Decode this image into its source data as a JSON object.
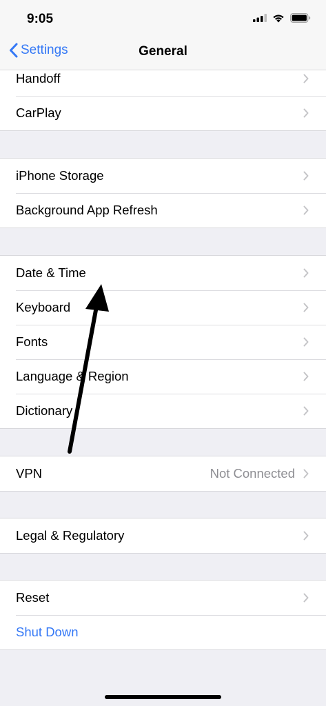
{
  "status_bar": {
    "time": "9:05",
    "icons": [
      "cellular-signal-icon",
      "wifi-icon",
      "battery-icon"
    ]
  },
  "nav": {
    "back_label": "Settings",
    "title": "General",
    "accent_color": "#3478f6"
  },
  "groups": [
    {
      "rows": [
        {
          "label": "Handoff"
        },
        {
          "label": "CarPlay"
        }
      ]
    },
    {
      "rows": [
        {
          "label": "iPhone Storage"
        },
        {
          "label": "Background App Refresh"
        }
      ]
    },
    {
      "rows": [
        {
          "label": "Date & Time"
        },
        {
          "label": "Keyboard"
        },
        {
          "label": "Fonts"
        },
        {
          "label": "Language & Region"
        },
        {
          "label": "Dictionary"
        }
      ]
    },
    {
      "rows": [
        {
          "label": "VPN",
          "value": "Not Connected"
        }
      ]
    },
    {
      "rows": [
        {
          "label": "Legal & Regulatory"
        }
      ]
    },
    {
      "rows": [
        {
          "label": "Reset"
        },
        {
          "label": "Shut Down"
        }
      ]
    }
  ],
  "annotation": {
    "icon": "arrow-annotation-icon",
    "points_to": "Date & Time"
  }
}
